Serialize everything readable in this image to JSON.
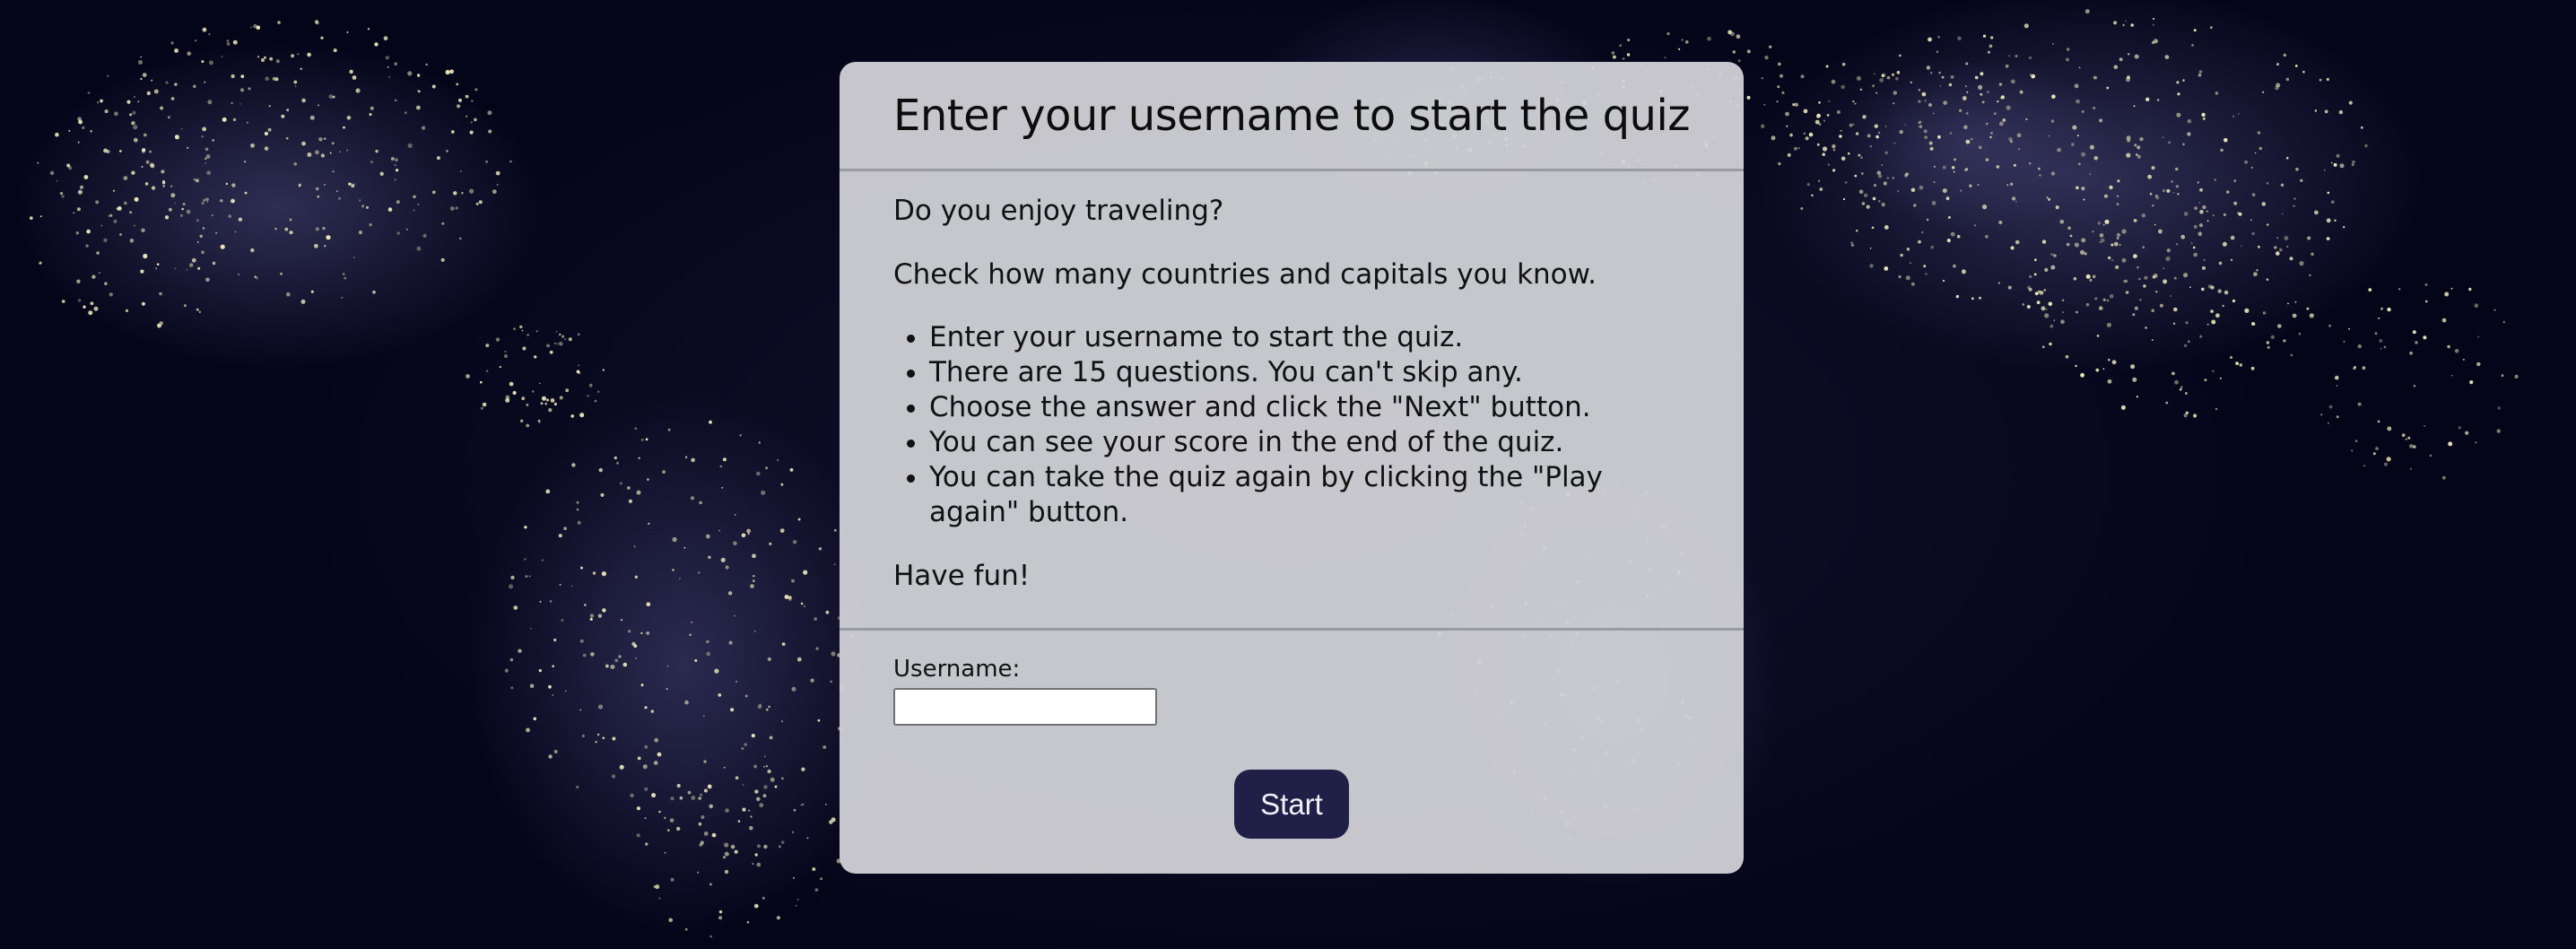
{
  "quiz": {
    "title": "Enter your username to start the quiz",
    "intro": "Do you enjoy traveling?",
    "check": "Check how many countries and capitals you know.",
    "rules": [
      "Enter your username to start the quiz.",
      "There are 15 questions. You can't skip any.",
      "Choose the answer and click the \"Next\" button.",
      "You can see your score in the end of the quiz.",
      "You can take the quiz again by clicking the \"Play again\" button."
    ],
    "closing": "Have fun!"
  },
  "form": {
    "username_label": "Username:",
    "username_value": "",
    "start_label": "Start"
  },
  "background": {
    "image": "world-map-night-lights"
  },
  "colors": {
    "card_bg": "#d2d2d8",
    "button_bg": "#1f1f48",
    "page_bg": "#07071a"
  }
}
